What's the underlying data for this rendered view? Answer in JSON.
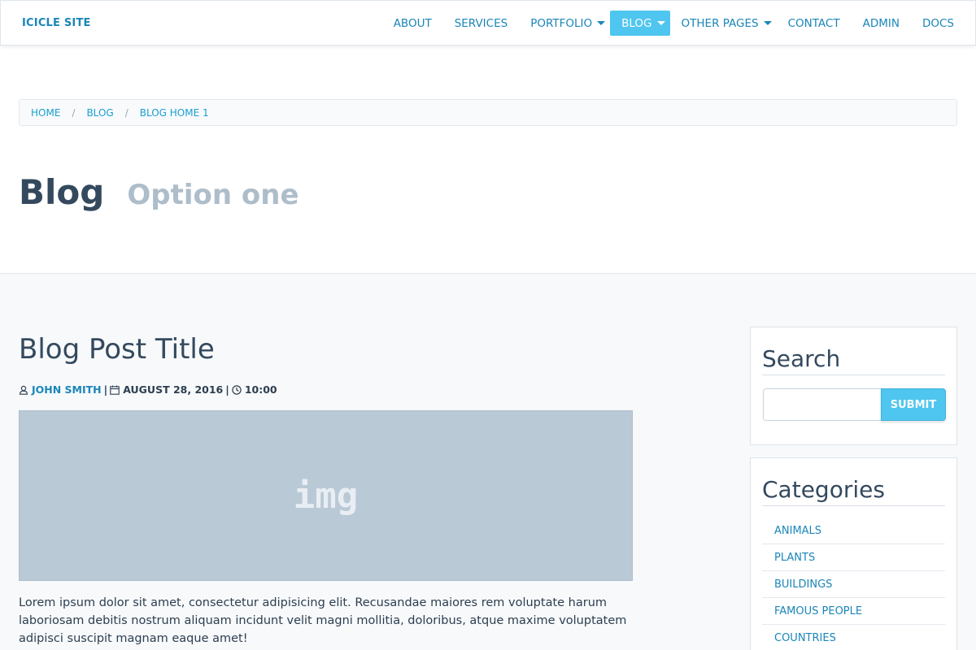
{
  "navbar": {
    "brand": "ICICLE SITE",
    "items": [
      {
        "label": "ABOUT"
      },
      {
        "label": "SERVICES"
      },
      {
        "label": "PORTFOLIO"
      },
      {
        "label": "BLOG"
      },
      {
        "label": "OTHER PAGES"
      },
      {
        "label": "CONTACT"
      },
      {
        "label": "ADMIN"
      },
      {
        "label": "DOCS"
      }
    ]
  },
  "breadcrumb": [
    "HOME",
    "BLOG",
    "BLOG HOME 1"
  ],
  "breadcrumb_separator": "/",
  "page": {
    "title": "Blog",
    "subtitle": "Option one"
  },
  "post": {
    "title": "Blog Post Title",
    "author": "JOHN SMITH",
    "date": "AUGUST 28, 2016",
    "time": "10:00",
    "meta_separator": "|",
    "image_placeholder": "img",
    "body": "Lorem ipsum dolor sit amet, consectetur adipisicing elit. Recusandae maiores rem voluptate harum laboriosam debitis nostrum aliquam incidunt velit magni mollitia, doloribus, atque maxime voluptatem adipisci suscipit magnam eaque amet!"
  },
  "sidebar": {
    "search": {
      "title": "Search",
      "submit_label": "SUBMIT",
      "value": ""
    },
    "categories": {
      "title": "Categories",
      "items": [
        "ANIMALS",
        "PLANTS",
        "BUILDINGS",
        "FAMOUS PEOPLE",
        "COUNTRIES"
      ]
    }
  },
  "colors": {
    "accent": "#4fc6ef",
    "link": "#1a86b8",
    "heading": "#34495e"
  },
  "icons": {
    "author": "user-icon",
    "date": "calendar-icon",
    "time": "clock-icon",
    "dropdown": "caret-down-icon"
  }
}
